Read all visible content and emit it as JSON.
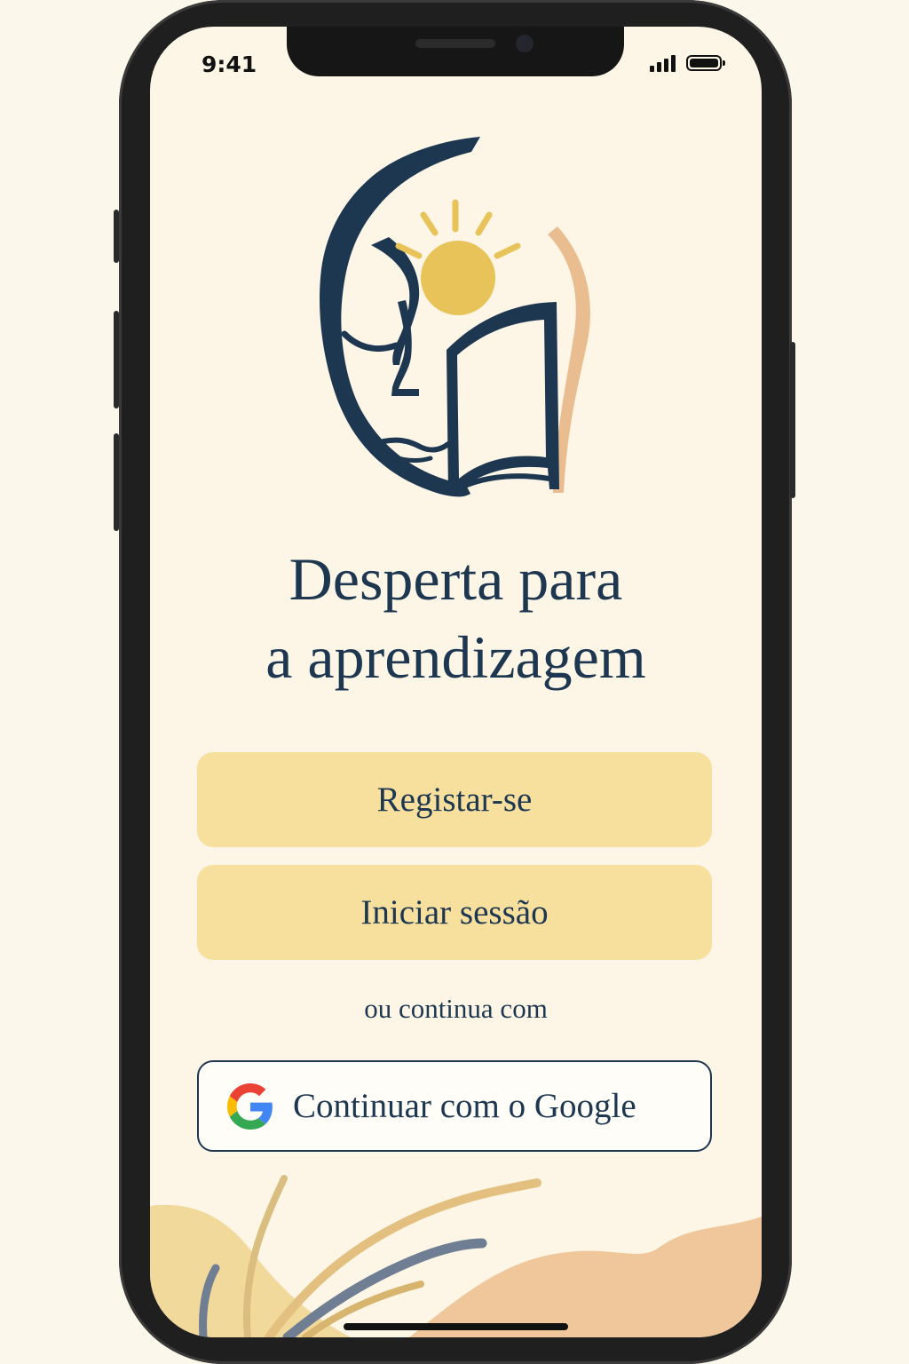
{
  "status_bar": {
    "time": "9:41",
    "signal_icon": "cellular-signal-icon",
    "battery_icon": "battery-icon"
  },
  "logo": {
    "icon": "face-book-sun-logo",
    "colors": {
      "navy": "#1d3751",
      "sun": "#e8c35a",
      "peach": "#e9bd90"
    }
  },
  "headline": {
    "line1": "Desperta para",
    "line2": "a aprendizagem"
  },
  "actions": {
    "register_label": "Registar-se",
    "login_label": "Iniciar sessão",
    "divider_text": "ou continua com",
    "google_label": "Continuar com o Google",
    "google_icon": "google-g-icon"
  },
  "colors": {
    "background": "#fdf6e6",
    "primary_button": "#f7df9e",
    "text": "#1d3751",
    "decor_yellow": "#f1d89b",
    "decor_peach": "#efc79b",
    "decor_slate": "#65758a"
  }
}
